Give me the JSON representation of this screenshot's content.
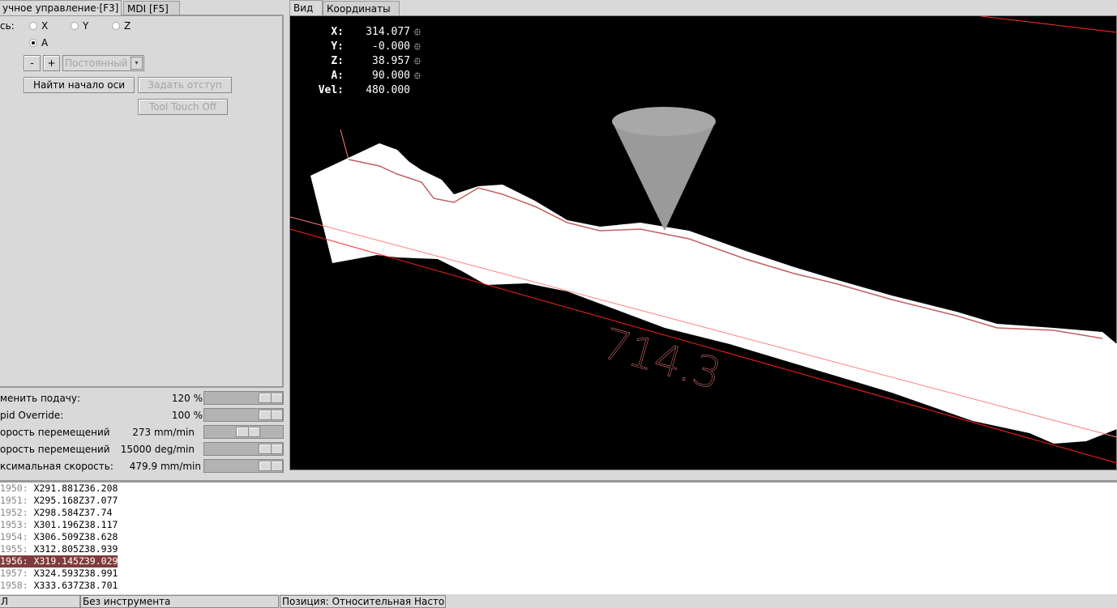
{
  "left_tabs": [
    {
      "label": "учное управление·[F3]"
    },
    {
      "label": "MDI [F5]"
    }
  ],
  "manual": {
    "axis_label": "сь:",
    "axes": [
      {
        "label": "X",
        "selected": false
      },
      {
        "label": "Y",
        "selected": false
      },
      {
        "label": "Z",
        "selected": false
      },
      {
        "label": "A",
        "selected": true
      }
    ],
    "minus": "-",
    "plus": "+",
    "jog_mode": "Постоянный",
    "home_button": "Найти начало оси",
    "touch_off_button": "Задать отступ",
    "tool_touch_off_button": "Tool Touch Off"
  },
  "sliders": [
    {
      "label": "менить подачу:",
      "value": "120 %",
      "percent": 100
    },
    {
      "label": "pid Override:",
      "value": "100 %",
      "percent": 100
    },
    {
      "label": "орость перемещений",
      "value": "273 mm/min",
      "percent": 57
    },
    {
      "label": "орость перемещений",
      "value": "15000 deg/min",
      "percent": 100
    },
    {
      "label": "ксимальная скорость:",
      "value": "479.9 mm/min",
      "percent": 100
    }
  ],
  "view_tabs": [
    {
      "label": "Вид"
    },
    {
      "label": "Координаты"
    }
  ],
  "dro": [
    {
      "axis": "X:",
      "value": "314.077",
      "homed": true
    },
    {
      "axis": "Y:",
      "value": "-0.000",
      "homed": true
    },
    {
      "axis": "Z:",
      "value": "38.957",
      "homed": true
    },
    {
      "axis": "A:",
      "value": "90.000",
      "homed": true
    },
    {
      "axis": "Vel:",
      "value": "480.000",
      "homed": false
    }
  ],
  "dimension_label": "714.3",
  "colors": {
    "selected_line": "#7f3c3c",
    "toolpath": "#ff5050",
    "view_bg": "#000000"
  },
  "gcode": [
    {
      "n": "1950:",
      "code": "X291.881Z36.208"
    },
    {
      "n": "1951:",
      "code": "X295.168Z37.077"
    },
    {
      "n": "1952:",
      "code": "X298.584Z37.74"
    },
    {
      "n": "1953:",
      "code": "X301.196Z38.117"
    },
    {
      "n": "1954:",
      "code": "X306.509Z38.628"
    },
    {
      "n": "1955:",
      "code": "X312.805Z38.939"
    },
    {
      "n": "1956:",
      "code": "X319.145Z39.029",
      "selected": true
    },
    {
      "n": "1957:",
      "code": "X324.593Z38.991"
    },
    {
      "n": "1958:",
      "code": "X333.637Z38.701"
    }
  ],
  "status": {
    "state": "Л",
    "tool": "Без инструмента",
    "position": "Позиция: Относительная Насто:"
  }
}
